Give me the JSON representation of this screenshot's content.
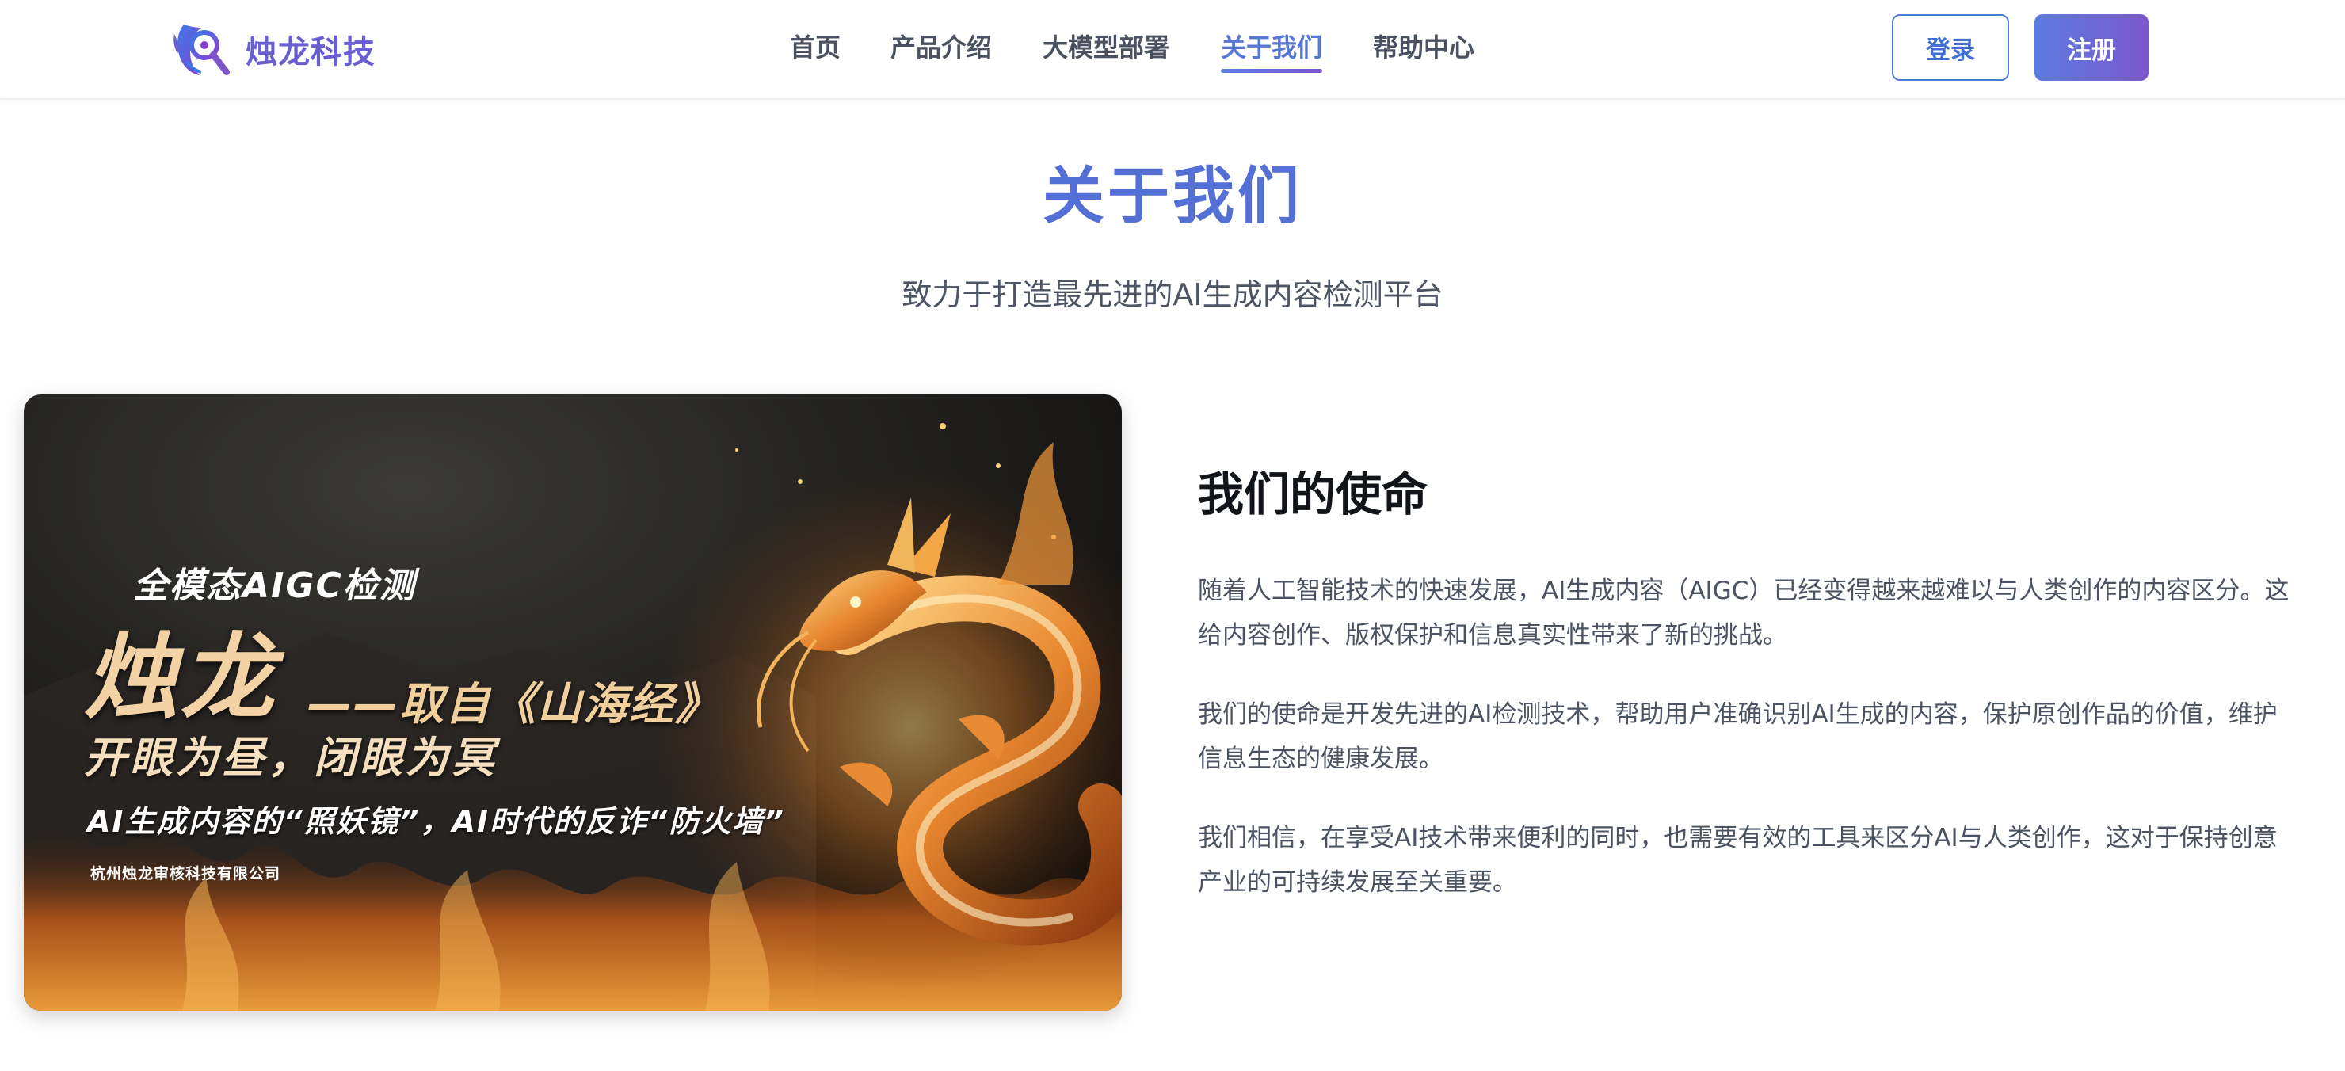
{
  "header": {
    "brand": "烛龙科技",
    "logo_icon": "dragon-eye-logo",
    "nav": [
      {
        "label": "首页",
        "active": false
      },
      {
        "label": "产品介绍",
        "active": false
      },
      {
        "label": "大模型部署",
        "active": false
      },
      {
        "label": "关于我们",
        "active": true
      },
      {
        "label": "帮助中心",
        "active": false
      }
    ],
    "login_label": "登录",
    "register_label": "注册"
  },
  "hero": {
    "title": "关于我们",
    "subtitle": "致力于打造最先进的AI生成内容检测平台"
  },
  "banner": {
    "tag": "全模态AIGC检测",
    "title": "烛龙",
    "source": "——取自《山海经》",
    "slogan": "开眼为昼，闭眼为冥",
    "tagline": "AI生成内容的“照妖镜”，AI时代的反诈“防火墙”",
    "company": "杭州烛龙审核科技有限公司"
  },
  "mission": {
    "title": "我们的使命",
    "paragraphs": [
      "随着人工智能技术的快速发展，AI生成内容（AIGC）已经变得越来越难以与人类创作的内容区分。这给内容创作、版权保护和信息真实性带来了新的挑战。",
      "我们的使命是开发先进的AI检测技术，帮助用户准确识别AI生成的内容，保护原创作品的价值，维护信息生态的健康发展。",
      "我们相信，在享受AI技术带来便利的同时，也需要有效的工具来区分AI与人类创作，这对于保持创意产业的可持续发展至关重要。"
    ]
  },
  "colors": {
    "accent": "#5570d4",
    "brand": "#6a5fd0",
    "nav_active": "#5878d6",
    "register_gradient_start": "#5d7be0",
    "register_gradient_end": "#7b58cc"
  }
}
